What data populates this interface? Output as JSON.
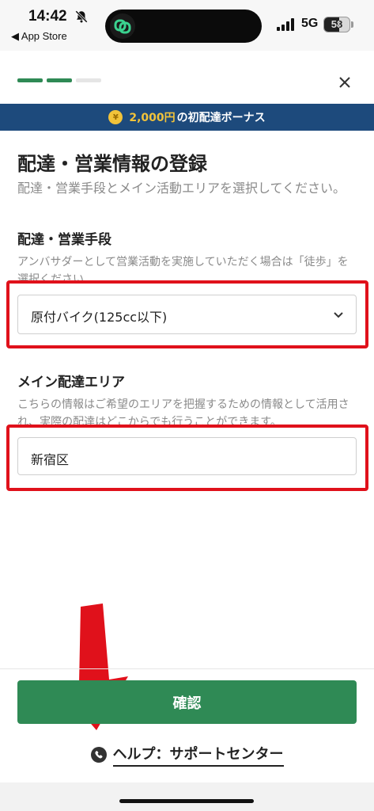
{
  "status_bar": {
    "time": "14:42",
    "back_app": "◀ App Store",
    "network": "5G",
    "battery": "58",
    "battery_level": 0.58
  },
  "progress": {
    "total_steps": 3,
    "completed_steps": 2,
    "active_color": "#2f8a55",
    "inactive_color": "#e5e5e5"
  },
  "banner": {
    "coin": "¥",
    "amount": "2,000円",
    "text": "の初配達ボーナス"
  },
  "page": {
    "title": "配達・営業情報の登録",
    "description": "配達・営業手段とメイン活動エリアを選択してください。"
  },
  "delivery_method": {
    "label": "配達・営業手段",
    "note": "アンバサダーとして営業活動を実施していただく場合は「徒歩」を選択ください",
    "value": "原付バイク(125cc以下)"
  },
  "main_area": {
    "label": "メイン配達エリア",
    "note": "こちらの情報はご希望のエリアを把握するための情報として活用され、実際の配達はどこからでも行うことができます。",
    "value": "新宿区"
  },
  "footer": {
    "confirm_label": "確認",
    "help_label": "ヘルプ：サポートセンター"
  },
  "colors": {
    "brand_green": "#2f8a55",
    "banner_navy": "#1d4a7c",
    "annotation_red": "#e0111b"
  }
}
